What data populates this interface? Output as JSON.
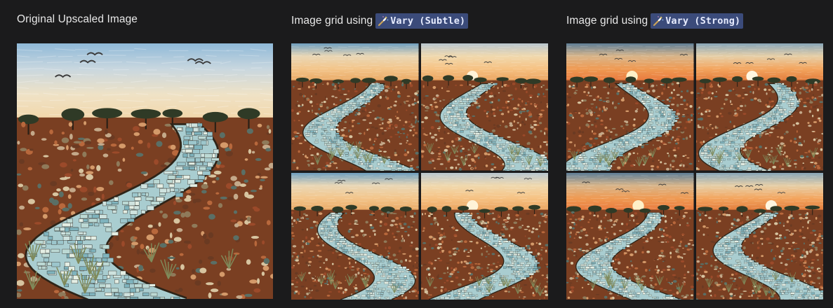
{
  "columns": [
    {
      "caption_text": "Original Upscaled Image",
      "has_tag": false,
      "tag_label": "",
      "images": [
        {
          "alt": "Original Upscaled Image",
          "variant": "day"
        }
      ]
    },
    {
      "caption_text": "Image grid using",
      "has_tag": true,
      "tag_label": "Vary (Subtle)",
      "images": [
        {
          "alt": "Vary (Subtle) 1",
          "variant": "dusk"
        },
        {
          "alt": "Vary (Subtle) 2",
          "variant": "dusk2"
        },
        {
          "alt": "Vary (Subtle) 3",
          "variant": "dusk"
        },
        {
          "alt": "Vary (Subtle) 4",
          "variant": "dusk2"
        }
      ]
    },
    {
      "caption_text": "Image grid using",
      "has_tag": true,
      "tag_label": "Vary (Strong)",
      "images": [
        {
          "alt": "Vary (Strong) 1",
          "variant": "sunset"
        },
        {
          "alt": "Vary (Strong) 2",
          "variant": "sunset2"
        },
        {
          "alt": "Vary (Strong) 3",
          "variant": "sunset"
        },
        {
          "alt": "Vary (Strong) 4",
          "variant": "sunset2"
        }
      ]
    }
  ],
  "colors": {
    "background": "#1b1b1c",
    "tag_bg": "#3b4b7a",
    "tag_text": "#e7ecff"
  },
  "icons": {
    "tag_icon": "magic-wand-icon"
  }
}
